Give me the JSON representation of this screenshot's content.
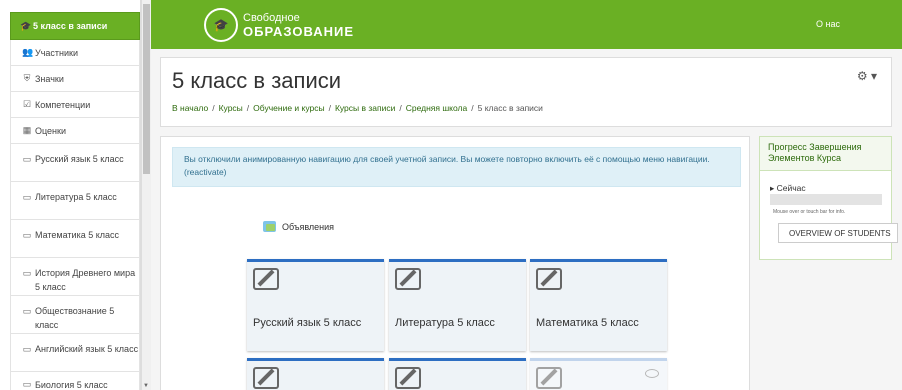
{
  "sidebar": {
    "active": "5 класс в записи",
    "items": [
      {
        "icon": "users-icon",
        "glyph": "👥",
        "label": "Участники"
      },
      {
        "icon": "shield-icon",
        "glyph": "⛨",
        "label": "Значки"
      },
      {
        "icon": "checkbox-icon",
        "glyph": "☑",
        "label": "Компетенции"
      },
      {
        "icon": "table-icon",
        "glyph": "▦",
        "label": "Оценки"
      },
      {
        "icon": "folder-icon",
        "glyph": "▭",
        "label": "Русский язык 5 класс"
      },
      {
        "icon": "folder-icon",
        "glyph": "▭",
        "label": "Литература 5 класс"
      },
      {
        "icon": "folder-icon",
        "glyph": "▭",
        "label": "Математика 5 класс"
      },
      {
        "icon": "folder-icon",
        "glyph": "▭",
        "label": "История Древнего мира 5 класс"
      },
      {
        "icon": "folder-icon",
        "glyph": "▭",
        "label": "Обществознание 5 класс"
      },
      {
        "icon": "folder-icon",
        "glyph": "▭",
        "label": "Английский язык 5 класс"
      },
      {
        "icon": "folder-icon",
        "glyph": "▭",
        "label": "Биология 5 класс"
      }
    ]
  },
  "header": {
    "logo_line1": "Свободное",
    "logo_line2": "ОБРАЗОВАНИЕ",
    "about": "О нас",
    "brand_color": "#6ab024"
  },
  "page": {
    "title": "5 класс в записи",
    "breadcrumbs": [
      "В начало",
      "Курсы",
      "Обучение и курсы",
      "Курсы в записи",
      "Средняя школа",
      "5 класс в записи"
    ]
  },
  "main": {
    "alert": "Вы отключили анимированную навигацию для своей учетной записи. Вы можете повторно включить её с помощью меню навигации. (reactivate)",
    "announcements": "Объявления",
    "tiles": [
      "Русский язык 5 класс",
      "Литература 5 класс",
      "Математика 5 класс"
    ]
  },
  "block": {
    "title": "Прогресс Завершения Элементов Курса",
    "now": "Сейчас",
    "hint": "Mouse over or touch bar for info.",
    "overview": "OVERVIEW OF STUDENTS"
  }
}
